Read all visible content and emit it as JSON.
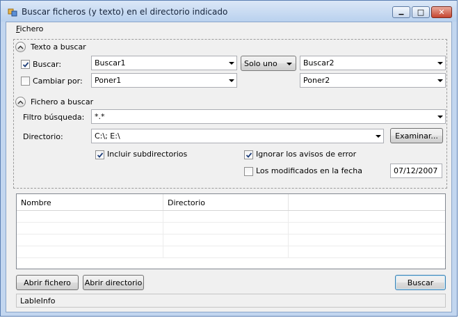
{
  "window": {
    "title": "Buscar ficheros (y texto) en el directorio indicado",
    "min_glyph": "▁",
    "max_glyph": "□",
    "close_glyph": "✕"
  },
  "menu": {
    "fichero_first": "F",
    "fichero_rest": "ichero"
  },
  "texto_section": {
    "header": "Texto a buscar",
    "buscar_label": "Buscar:",
    "buscar_checked": true,
    "buscar1_value": "Buscar1",
    "mode_button": "Solo uno",
    "buscar2_value": "Buscar2",
    "cambiar_label": "Cambiar por:",
    "cambiar_checked": false,
    "poner1_value": "Poner1",
    "poner2_value": "Poner2"
  },
  "fichero_section": {
    "header": "Fichero a buscar",
    "filtro_label": "Filtro búsqueda:",
    "filtro_value": "*.*",
    "directorio_label": "Directorio:",
    "directorio_value": "C:\\; E:\\",
    "examinar_button": "Examinar...",
    "incluir_label": "Incluir subdirectorios",
    "incluir_checked": true,
    "ignorar_label": "Ignorar los avisos de error",
    "ignorar_checked": true,
    "modificados_label": "Los modificados en la fecha",
    "modificados_checked": false,
    "fecha_value": "07/12/2007"
  },
  "results": {
    "columns": [
      "Nombre",
      "Directorio",
      ""
    ],
    "rows": [
      [
        "",
        "",
        ""
      ],
      [
        "",
        "",
        ""
      ],
      [
        "",
        "",
        ""
      ],
      [
        "",
        "",
        ""
      ]
    ]
  },
  "buttons": {
    "abrir_fichero": "Abrir fichero",
    "abrir_directorio": "Abrir directorio",
    "buscar": "Buscar"
  },
  "status": {
    "label": "LableInfo"
  },
  "colors": {
    "check": "#1f3f7a",
    "accent": "#3c7fb1"
  }
}
